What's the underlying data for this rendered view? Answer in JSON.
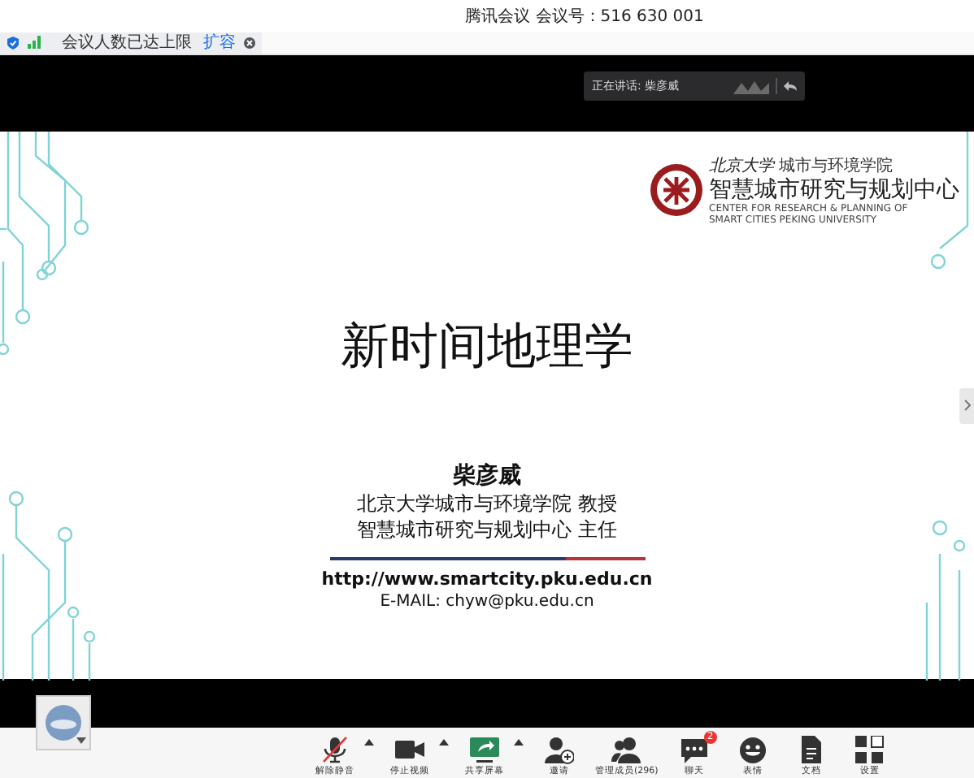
{
  "window": {
    "title": "腾讯会议 会议号：516 630 001"
  },
  "notice": {
    "text": "会议人数已达上限",
    "link": "扩容"
  },
  "speaker": {
    "label": "正在讲话: 柴彦威"
  },
  "slide": {
    "logo": {
      "university": "北京大学",
      "school": "城市与环境学院",
      "center": "智慧城市研究与规划中心",
      "english": "CENTER FOR RESEARCH & PLANNING OF SMART CITIES PEKING UNIVERSITY"
    },
    "title": "新时间地理学",
    "author": "柴彦威",
    "affiliations": [
      "北京大学城市与环境学院 教授",
      "智慧城市研究与规划中心 主任"
    ],
    "url": "http://www.smartcity.pku.edu.cn",
    "email": "E-MAIL: chyw@pku.edu.cn"
  },
  "toolbar": [
    {
      "kind": "mic",
      "label": "解除静音",
      "caret": true
    },
    {
      "kind": "video",
      "label": "停止视频",
      "caret": true
    },
    {
      "kind": "share",
      "label": "共享屏幕",
      "caret": true
    },
    {
      "kind": "invite",
      "label": "邀请",
      "caret": false
    },
    {
      "kind": "members",
      "label": "管理成员(296)",
      "caret": false
    },
    {
      "kind": "chat",
      "label": "聊天",
      "caret": false,
      "badge": "2"
    },
    {
      "kind": "emoji",
      "label": "表情",
      "caret": false
    },
    {
      "kind": "doc",
      "label": "文档",
      "caret": false
    },
    {
      "kind": "settings",
      "label": "设置",
      "caret": false
    }
  ]
}
